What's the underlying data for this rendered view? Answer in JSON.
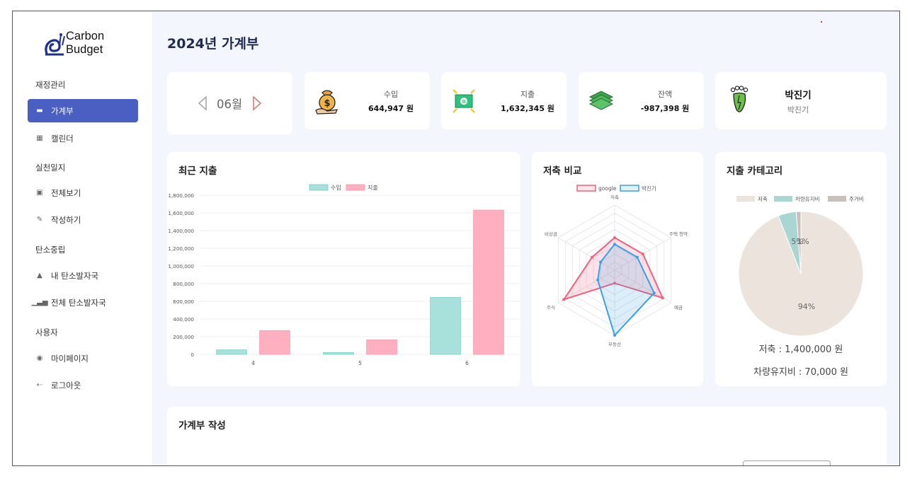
{
  "brand": {
    "line1": "Carbon",
    "line2": "Budget"
  },
  "sidebar": {
    "sections": [
      {
        "label": "재정관리"
      },
      {
        "label": "실천일지"
      },
      {
        "label": "탄소중립"
      },
      {
        "label": "사용자"
      }
    ],
    "items": [
      {
        "label": "가계부",
        "icon": "wallet-icon"
      },
      {
        "label": "캘린더",
        "icon": "calendar-icon"
      },
      {
        "label": "전체보기",
        "icon": "document-icon"
      },
      {
        "label": "작성하기",
        "icon": "pencil-icon"
      },
      {
        "label": "내 탄소발자국",
        "icon": "tree-icon"
      },
      {
        "label": "전체 탄소발자국",
        "icon": "bar-chart-icon"
      },
      {
        "label": "마이페이지",
        "icon": "user-icon"
      },
      {
        "label": "로그아웃",
        "icon": "logout-icon"
      }
    ]
  },
  "header": {
    "title": "2024년 가계부"
  },
  "month": {
    "label": "06월"
  },
  "stats": {
    "income": {
      "label": "수입",
      "value": "644,947 원"
    },
    "expense": {
      "label": "지출",
      "value": "1,632,345 원"
    },
    "balance": {
      "label": "잔액",
      "value": "-987,398 원"
    },
    "user": {
      "name": "박진기",
      "sub": "박진기"
    }
  },
  "recent_title": "최근 지출",
  "savings_title": "저축 비교",
  "category_title": "지출 카테고리",
  "category_summary": [
    "저축 : 1,400,000 원",
    "차량유지비 : 70,000 원"
  ],
  "form_title": "가계부 작성",
  "colors": {
    "accent": "#4a5fc1",
    "income": "#a8e0dc",
    "expense": "#ffafc0",
    "google": "#f0607e",
    "user": "#3ba0e6"
  },
  "chart_data": [
    {
      "type": "bar",
      "categories": [
        "4",
        "5",
        "6"
      ],
      "series": [
        {
          "name": "수입",
          "values": [
            52000,
            22000,
            644947
          ]
        },
        {
          "name": "지출",
          "values": [
            270000,
            165000,
            1632345
          ]
        }
      ],
      "yticks": [
        "1,800,000",
        "1,600,000",
        "1,400,000",
        "1,200,000",
        "1,000,000",
        "800,000",
        "600,000",
        "400,000",
        "200,000",
        "0"
      ],
      "ylim": [
        0,
        1800000
      ],
      "legend": "top"
    },
    {
      "type": "radar",
      "axes": [
        "저축",
        "주택 청약",
        "예금",
        "부동산",
        "주식",
        "비상금"
      ],
      "series": [
        {
          "name": "google",
          "values": [
            0.5,
            0.5,
            0.85,
            0.2,
            0.9,
            0.4
          ]
        },
        {
          "name": "박진기",
          "values": [
            0.4,
            0.4,
            0.7,
            1.0,
            0.3,
            0.25
          ]
        }
      ],
      "legend": "top"
    },
    {
      "type": "pie",
      "labels": [
        "저축",
        "차량유지비",
        "주거비"
      ],
      "values": [
        1400000,
        70000,
        18000
      ],
      "slice_labels": [
        "94%",
        "5%",
        "1%"
      ],
      "legend": "top"
    }
  ]
}
